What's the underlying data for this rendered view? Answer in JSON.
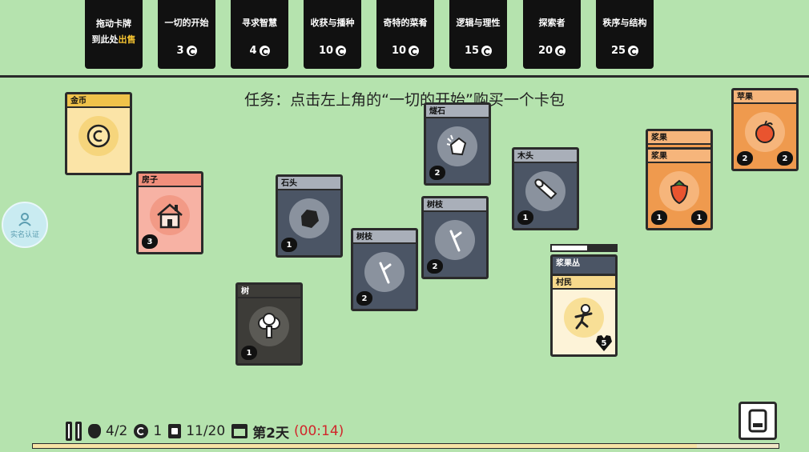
{
  "shop": {
    "sell_line1": "拖动卡牌",
    "sell_line2_a": "到此处",
    "sell_line2_b": "出售",
    "packs": [
      {
        "name": "一切的开始",
        "cost": "3"
      },
      {
        "name": "寻求智慧",
        "cost": "4"
      },
      {
        "name": "收获与播种",
        "cost": "10"
      },
      {
        "name": "奇特的菜肴",
        "cost": "10"
      },
      {
        "name": "逻辑与理性",
        "cost": "15"
      },
      {
        "name": "探索者",
        "cost": "20"
      },
      {
        "name": "秩序与结构",
        "cost": "25"
      }
    ]
  },
  "task": "任务：点击左上角的“一切的开始”购买一个卡包",
  "cards": {
    "coin": {
      "title": "金币"
    },
    "house": {
      "title": "房子",
      "count": "3"
    },
    "stone": {
      "title": "石头",
      "count": "1"
    },
    "tree": {
      "title": "树",
      "count": "1"
    },
    "flint": {
      "title": "燧石",
      "count": "2"
    },
    "branch1": {
      "title": "树枝",
      "count": "2"
    },
    "branch2": {
      "title": "树枝",
      "count": "2"
    },
    "wood": {
      "title": "木头",
      "count": "1"
    },
    "berry_top": {
      "title": "浆果"
    },
    "berry": {
      "title": "浆果",
      "count_left": "1",
      "count_right": "1"
    },
    "apple": {
      "title": "苹果",
      "count_left": "2",
      "count_right": "2"
    },
    "bush": {
      "title": "浆果丛"
    },
    "villager": {
      "title": "村民",
      "health": "5"
    }
  },
  "bush_progress": 0.55,
  "verify_label": "实名认证",
  "status": {
    "food": "4/2",
    "coins": "1",
    "cards": "11/20",
    "day": "第2天",
    "timer": "(00:14)",
    "day_progress": 0.89
  },
  "colors": {
    "background": "#b5e3ae",
    "timer": "#d1262b",
    "sell_highlight": "#f6c431"
  }
}
